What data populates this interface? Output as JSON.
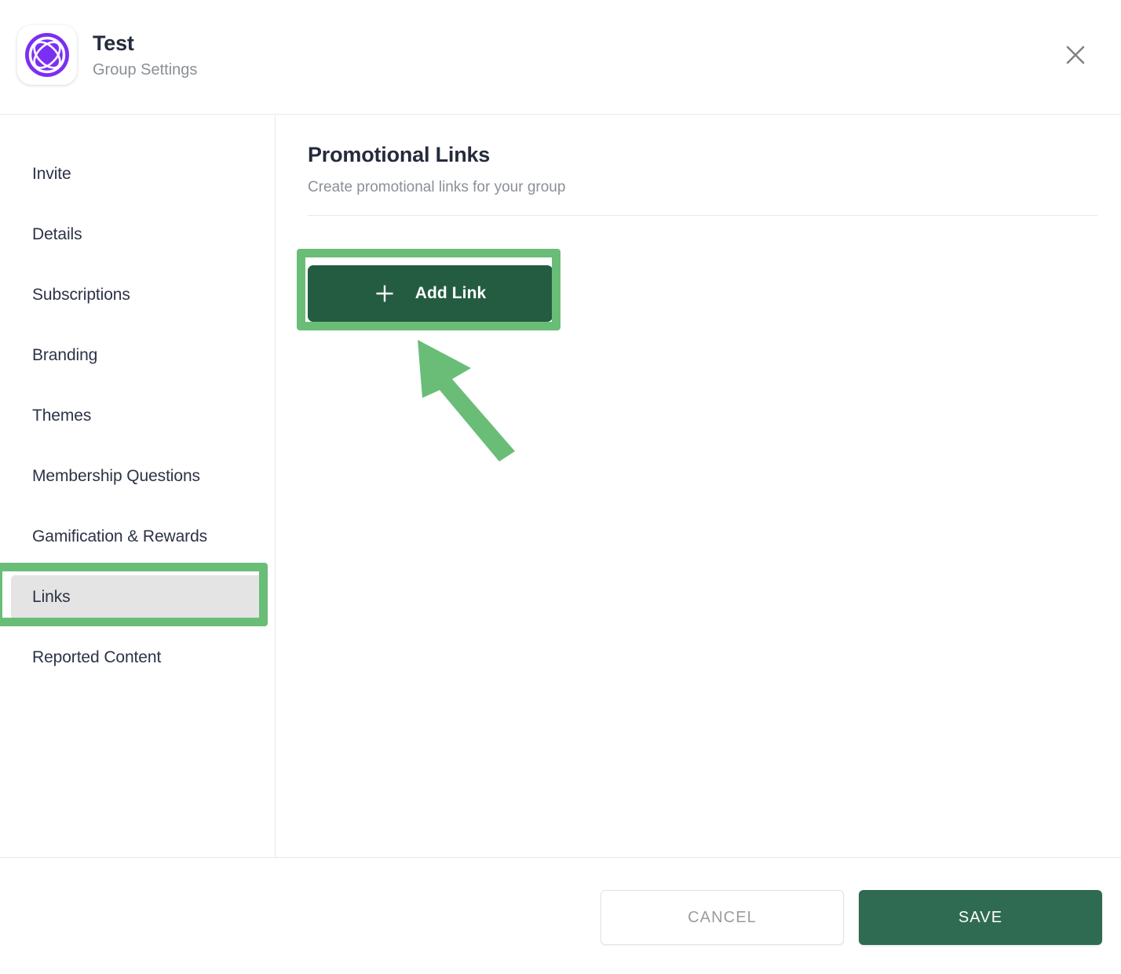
{
  "header": {
    "title": "Test",
    "subtitle": "Group Settings",
    "logo_icon": "group-logo-icon",
    "logo_color": "#7b2ff2",
    "close_icon": "close-icon"
  },
  "sidebar": {
    "items": [
      {
        "label": "Invite",
        "active": false
      },
      {
        "label": "Details",
        "active": false
      },
      {
        "label": "Subscriptions",
        "active": false
      },
      {
        "label": "Branding",
        "active": false
      },
      {
        "label": "Themes",
        "active": false
      },
      {
        "label": "Membership Questions",
        "active": false
      },
      {
        "label": "Gamification & Rewards",
        "active": false
      },
      {
        "label": "Links",
        "active": true
      },
      {
        "label": "Reported Content",
        "active": false
      }
    ],
    "active_background": "#e4e4e4"
  },
  "main": {
    "title": "Promotional Links",
    "subtitle": "Create promotional links for your group",
    "add_link_label": "Add Link",
    "add_link_icon": "plus-icon",
    "add_link_color": "#245c42"
  },
  "footer": {
    "cancel_label": "CANCEL",
    "save_label": "SAVE",
    "save_color": "#2e6b52"
  },
  "annotations": {
    "color": "#6abd77",
    "highlight_targets": [
      "add-link-button",
      "sidebar-item-links"
    ],
    "arrow_icon": "pointer-arrow-icon"
  }
}
